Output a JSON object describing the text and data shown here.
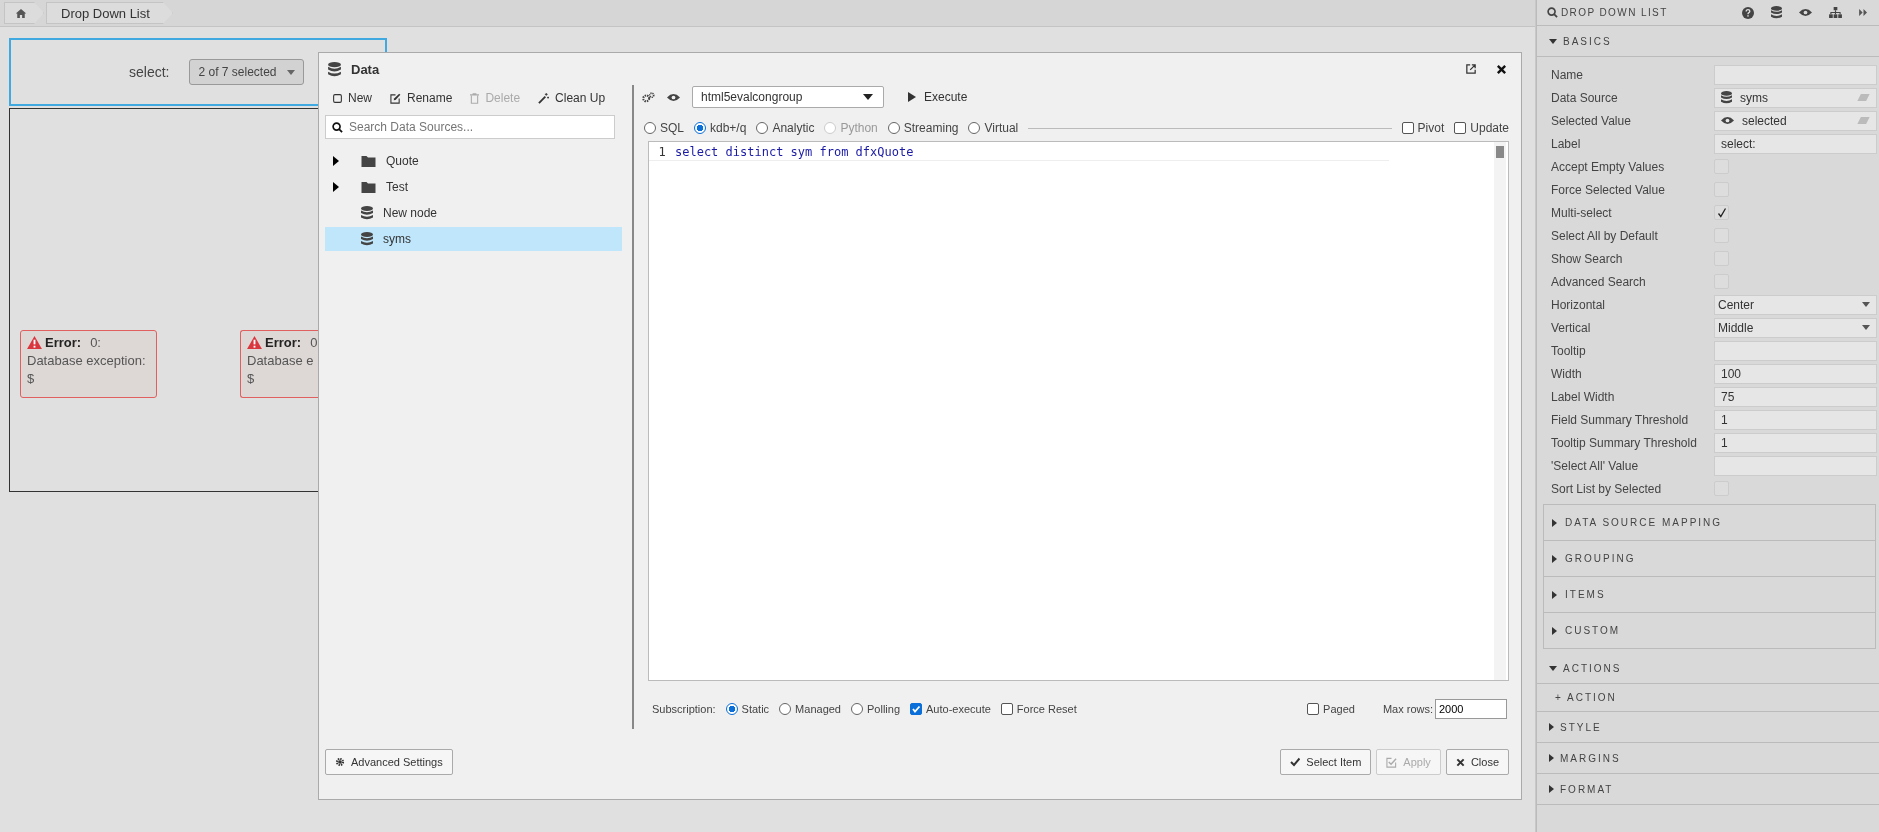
{
  "breadcrumb": {
    "items": [
      "Drop Down List"
    ]
  },
  "widget": {
    "label": "select:",
    "value": "2 of 7 selected"
  },
  "errors": [
    {
      "title": "Error:",
      "code": "0:",
      "message": "Database exception:",
      "detail": "$"
    },
    {
      "title": "Error:",
      "code": "0",
      "message": "Database e",
      "detail": "$"
    }
  ],
  "dialog": {
    "title": "Data",
    "toolbar": [
      {
        "label": "New",
        "kind": "new",
        "disabled": false
      },
      {
        "label": "Rename",
        "kind": "rename",
        "disabled": false
      },
      {
        "label": "Delete",
        "kind": "delete",
        "disabled": true
      },
      {
        "label": "Clean Up",
        "kind": "cleanup",
        "disabled": false
      }
    ],
    "search": {
      "placeholder": "Search Data Sources..."
    },
    "tree": [
      {
        "label": "Quote",
        "kind": "folder",
        "selected": false
      },
      {
        "label": "Test",
        "kind": "folder",
        "selected": false
      },
      {
        "label": "New node",
        "kind": "source",
        "selected": false
      },
      {
        "label": "syms",
        "kind": "source",
        "selected": true
      }
    ],
    "connection": "html5evalcongroup",
    "execute": "Execute",
    "modes": [
      {
        "label": "SQL",
        "selected": false,
        "disabled": false
      },
      {
        "label": "kdb+/q",
        "selected": true,
        "disabled": false
      },
      {
        "label": "Analytic",
        "selected": false,
        "disabled": false
      },
      {
        "label": "Python",
        "selected": false,
        "disabled": true
      },
      {
        "label": "Streaming",
        "selected": false,
        "disabled": false
      },
      {
        "label": "Virtual",
        "selected": false,
        "disabled": false
      }
    ],
    "options": [
      {
        "label": "Pivot",
        "checked": false
      },
      {
        "label": "Update",
        "checked": false
      }
    ],
    "code_lines": [
      {
        "number": "1",
        "text": "select distinct sym from dfxQuote"
      }
    ],
    "subscription": {
      "label": "Subscription:",
      "options": [
        {
          "label": "Static",
          "selected": true
        },
        {
          "label": "Managed",
          "selected": false
        },
        {
          "label": "Polling",
          "selected": false
        }
      ]
    },
    "flags": [
      {
        "label": "Auto-execute",
        "checked": true
      },
      {
        "label": "Force Reset",
        "checked": false
      }
    ],
    "paged": {
      "label": "Paged",
      "checked": false
    },
    "max_rows": {
      "label": "Max rows:",
      "value": "2000"
    },
    "advanced": "Advanced Settings",
    "buttons": [
      {
        "label": "Select Item",
        "kind": "select",
        "disabled": false
      },
      {
        "label": "Apply",
        "kind": "apply",
        "disabled": true
      },
      {
        "label": "Close",
        "kind": "close",
        "disabled": false
      }
    ]
  },
  "panel": {
    "title": "DROP DOWN LIST",
    "basics": {
      "title": "BASICS",
      "expanded": true,
      "properties": [
        {
          "label": "Name",
          "kind": "text"
        },
        {
          "label": "Data Source",
          "kind": "source",
          "value": "syms"
        },
        {
          "label": "Selected Value",
          "kind": "binding",
          "value": "selected"
        },
        {
          "label": "Label",
          "kind": "text",
          "value": "select:"
        },
        {
          "label": "Accept Empty Values",
          "kind": "checkbox",
          "checked": false
        },
        {
          "label": "Force Selected Value",
          "kind": "checkbox",
          "checked": false
        },
        {
          "label": "Multi-select",
          "kind": "checkbox",
          "checked": true
        },
        {
          "label": "Select All by Default",
          "kind": "checkbox",
          "checked": false
        },
        {
          "label": "Show Search",
          "kind": "checkbox",
          "checked": false
        },
        {
          "label": "Advanced Search",
          "kind": "checkbox",
          "checked": false
        },
        {
          "label": "Horizontal",
          "kind": "select",
          "value": "Center"
        },
        {
          "label": "Vertical",
          "kind": "select",
          "value": "Middle"
        },
        {
          "label": "Tooltip",
          "kind": "text"
        },
        {
          "label": "Width",
          "kind": "text",
          "value": "100"
        },
        {
          "label": "Label Width",
          "kind": "text",
          "value": "75"
        },
        {
          "label": "Field Summary Threshold",
          "kind": "text",
          "value": "1"
        },
        {
          "label": "Tooltip Summary Threshold",
          "kind": "text",
          "value": "1"
        },
        {
          "label": "'Select All' Value",
          "kind": "text"
        },
        {
          "label": "Sort List by Selected",
          "kind": "checkbox",
          "checked": false
        }
      ],
      "sub_sections": [
        {
          "title": "DATA SOURCE MAPPING",
          "expanded": false
        },
        {
          "title": "GROUPING",
          "expanded": false
        },
        {
          "title": "ITEMS",
          "expanded": false
        },
        {
          "title": "CUSTOM",
          "expanded": false
        }
      ]
    },
    "sections": [
      {
        "title": "ACTIONS",
        "expanded": true,
        "items": [
          "+ ACTION"
        ]
      },
      {
        "title": "STYLE",
        "expanded": false
      },
      {
        "title": "MARGINS",
        "expanded": false
      },
      {
        "title": "FORMAT",
        "expanded": false
      }
    ]
  }
}
